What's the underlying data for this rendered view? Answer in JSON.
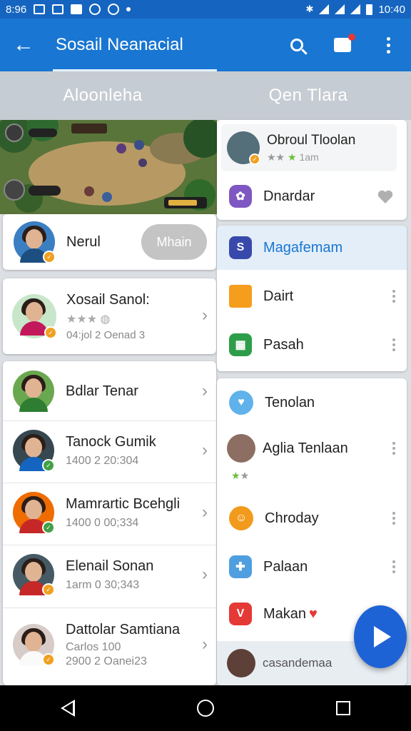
{
  "status_bar": {
    "time_left": "8:96",
    "time_right": "10:40"
  },
  "app_bar": {
    "title": "Sosail Neanacial"
  },
  "tabs": [
    {
      "label": "Aloonleha"
    },
    {
      "label": "Qen Tlara"
    }
  ],
  "left_list": {
    "pinned": {
      "name": "Nerul",
      "action_label": "Mhain"
    },
    "featured": {
      "name": "Xosail Sanol:",
      "meta": "04:jol 2 Oenad 3"
    },
    "contacts": [
      {
        "name": "Bdlar Tenar",
        "sub": ""
      },
      {
        "name": "Tanock Gumik",
        "sub": "1400 2 20:304"
      },
      {
        "name": "Mamrartic Bcehgli",
        "sub": "1400 0 00;334"
      },
      {
        "name": "Elenail Sonan",
        "sub": "1arm 0 30;343"
      },
      {
        "name": "Dattolar Samtiana",
        "sub": "Carlos 100",
        "sub2": "2900 2 Oanei23"
      }
    ]
  },
  "right_list": {
    "profile": {
      "name": "Obroul Tloolan",
      "meta": "1am"
    },
    "items": [
      {
        "label": "Dnardar",
        "icon": "flower-app-icon",
        "color": "#7e57c2"
      },
      {
        "label": "Magafemam",
        "icon": "s-app-icon",
        "color": "#3949ab",
        "selected": true
      },
      {
        "label": "Dairt",
        "icon": "folder-icon",
        "color": "#f59d1c"
      },
      {
        "label": "Pasah",
        "icon": "grid-app-icon",
        "color": "#2e9d4a"
      },
      {
        "label": "Tenolan",
        "icon": "bird-app-icon",
        "color": "#5fb2ea"
      },
      {
        "label": "Aglia Tenlaan",
        "icon": "avatar"
      },
      {
        "label": "Chroday",
        "icon": "sun-app-icon",
        "color": "#f29a1c"
      },
      {
        "label": "Palaan",
        "icon": "puzzle-app-icon",
        "color": "#4f9fe0"
      },
      {
        "label": "Makan",
        "icon": "v-app-icon",
        "color": "#e53935"
      }
    ],
    "footer": {
      "label": "casandemaa"
    }
  },
  "colors": {
    "primary": "#1976d2",
    "status": "#1565c0",
    "selected_row": "#e3eef8",
    "selected_text": "#1976d2"
  }
}
